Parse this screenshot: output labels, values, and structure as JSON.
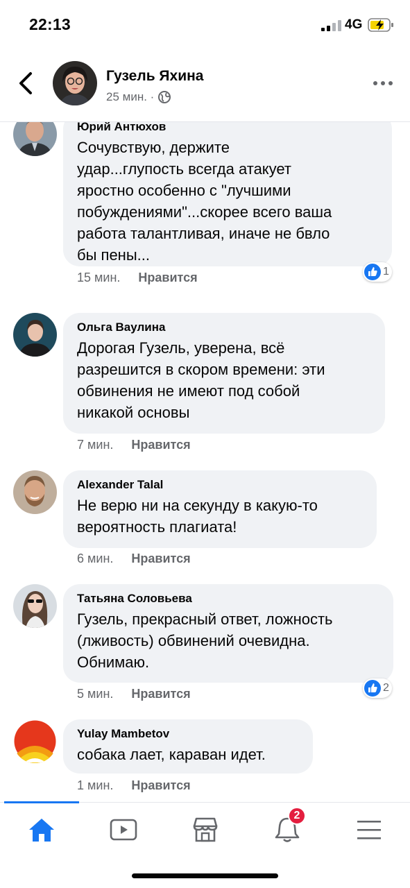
{
  "status": {
    "time": "22:13",
    "network": "4G"
  },
  "header": {
    "name": "Гузель Яхина",
    "time": "25 мин. ·"
  },
  "comments": [
    {
      "author": "Юрий Антюхов",
      "text": "Сочувствую, держите\nудар...глупость всегда атакует\nяростно особенно с \"лучшими\nпобуждениями\"...скорее всего ваша\nработа талантливая, иначе не бвло\nбы пены...",
      "time": "15 мин.",
      "like": "Нравится",
      "reactions": "1"
    },
    {
      "author": "Ольга Ваулина",
      "text": "Дорогая Гузель, уверена, всё\nразрешится в скором времени: эти\nобвинения не имеют под собой\nникакой основы",
      "time": "7 мин.",
      "like": "Нравится"
    },
    {
      "author": "Alexander Talal",
      "text": "Не верю ни на секунду в какую-то\nвероятность плагиата!",
      "time": "6 мин.",
      "like": "Нравится"
    },
    {
      "author": "Татьяна Соловьева",
      "text": "Гузель, прекрасный ответ, ложность\n(лживость) обвинений очевидна.\nОбнимаю.",
      "time": "5 мин.",
      "like": "Нравится",
      "reactions": "2"
    },
    {
      "author": "Yulay Mambetov",
      "text": "собака лает, караван идет.",
      "time": "1 мин.",
      "like": "Нравится"
    }
  ],
  "tabbar": {
    "notifications_badge": "2"
  },
  "colors": {
    "accent": "#1877f2",
    "bubble": "#f0f2f5",
    "badge": "#e41e3f"
  },
  "icons": [
    "back-icon",
    "globe-icon",
    "more-icon",
    "like-icon",
    "home-icon",
    "video-icon",
    "marketplace-icon",
    "bell-icon",
    "menu-icon"
  ]
}
